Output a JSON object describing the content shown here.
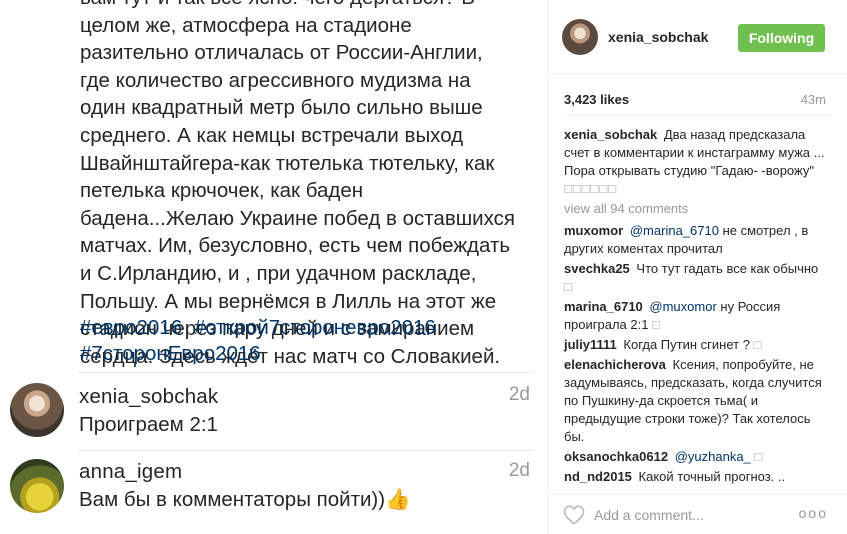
{
  "post": {
    "caption": "вам тут-и так всё ясно: чего дёргаться? В\nцелом же, атмосфера на стадионе\nразительно отличалась от России-Англии,\nгде количество агрессивного мудизма на\nодин квадратный метр было сильно выше\nсреднего. А как немцы встречали выход\nШвайнштайгера-как тютелька тютельку, как\nпетелька крючочек, как баден\nбадена...Желаю Украине побед в оставшихся\nматчах. Им, безусловно, есть чем побеждать\nи С.Ирландию, и , при удачном раскладе,\nПольшу.  А мы вернёмся в Лилль на этот же\nстадион через пару дней и с замиранием\nсердца. Здесь ждёт нас матч со Словакией.",
    "hashtags": [
      "#евро2016",
      "#открой7стороневро2016",
      "#7сторонЕвро2016"
    ]
  },
  "comments": [
    {
      "user": "xenia_sobchak",
      "text": "Проиграем 2:1",
      "time": "2d"
    },
    {
      "user": "anna_igem",
      "text": "Вам бы в комментаторы пойти))👍",
      "time": "2d"
    }
  ],
  "panel": {
    "header": {
      "username": "xenia_sobchak",
      "follow_label": "Following"
    },
    "likes": "3,423 likes",
    "time_ago": "43m",
    "caption": {
      "user": "xenia_sobchak",
      "text": "Два назад предсказала счет в комментарии к инстаграмму мужа ... Пора открывать студию \"Гадаю-      -ворожу\"",
      "boxes": "□□□□□□"
    },
    "view_all": "view all 94 comments",
    "items": [
      {
        "user": "muxomor",
        "mention": "@marina_6710",
        "text": "не смотрел , в других коментах прочитал"
      },
      {
        "user": "svechka25",
        "text": "Что тут гадать все как обычно",
        "boxes": "□"
      },
      {
        "user": "marina_6710",
        "mention": "@muxomor",
        "text": "ну Россия проиграла 2:1",
        "boxes": "□"
      },
      {
        "user": "juliy1111",
        "text": "Когда Путин сгинет ?",
        "boxes": "□"
      },
      {
        "user": "elenachicherova",
        "text": "Ксения, попробуйте, не задумываясь, предсказать, когда случится по Пушкину-да скроется тьма( и предыдущие строки тоже)? Так хотелось бы."
      },
      {
        "user": "oksanochka0612",
        "mention": "@yuzhanka_",
        "boxes": "□"
      },
      {
        "user": "nd_nd2015",
        "text": "Какой точный прогноз. .."
      }
    ],
    "add_comment_placeholder": "Add a comment...",
    "more_label": "ooo"
  }
}
